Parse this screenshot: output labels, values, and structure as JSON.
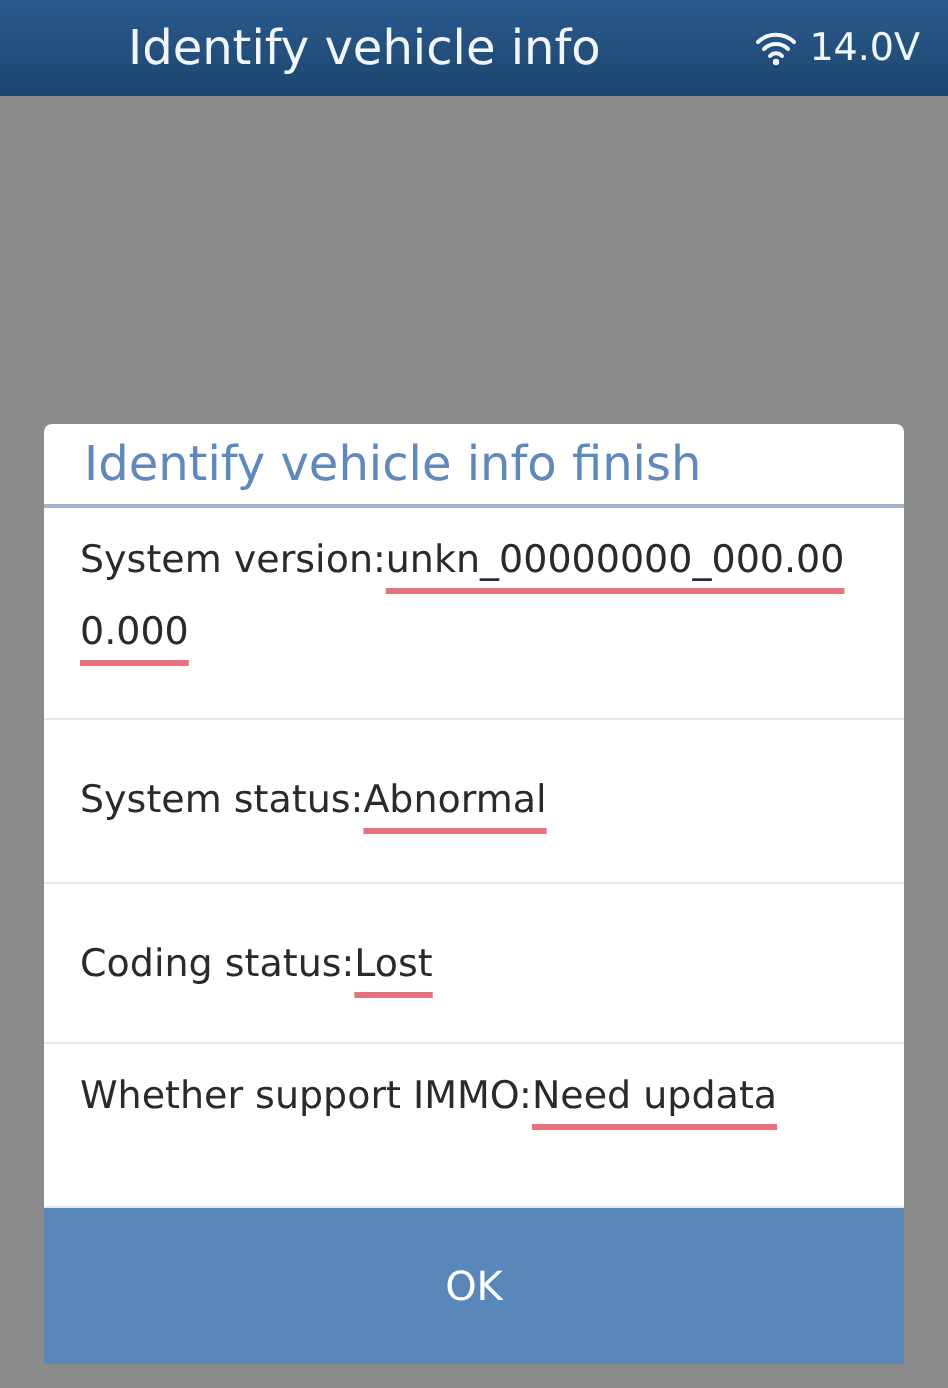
{
  "header": {
    "title": "Identify vehicle info",
    "voltage": "14.0V"
  },
  "dialog": {
    "title": "Identify vehicle info finish",
    "rows": [
      {
        "label": "System version:",
        "value": "unkn_00000000_000.000.000"
      },
      {
        "label": "System status:",
        "value": "Abnormal"
      },
      {
        "label": "Coding status:",
        "value": "Lost"
      },
      {
        "label": "Whether support IMMO:",
        "value": "Need updata"
      }
    ],
    "button": "OK"
  }
}
